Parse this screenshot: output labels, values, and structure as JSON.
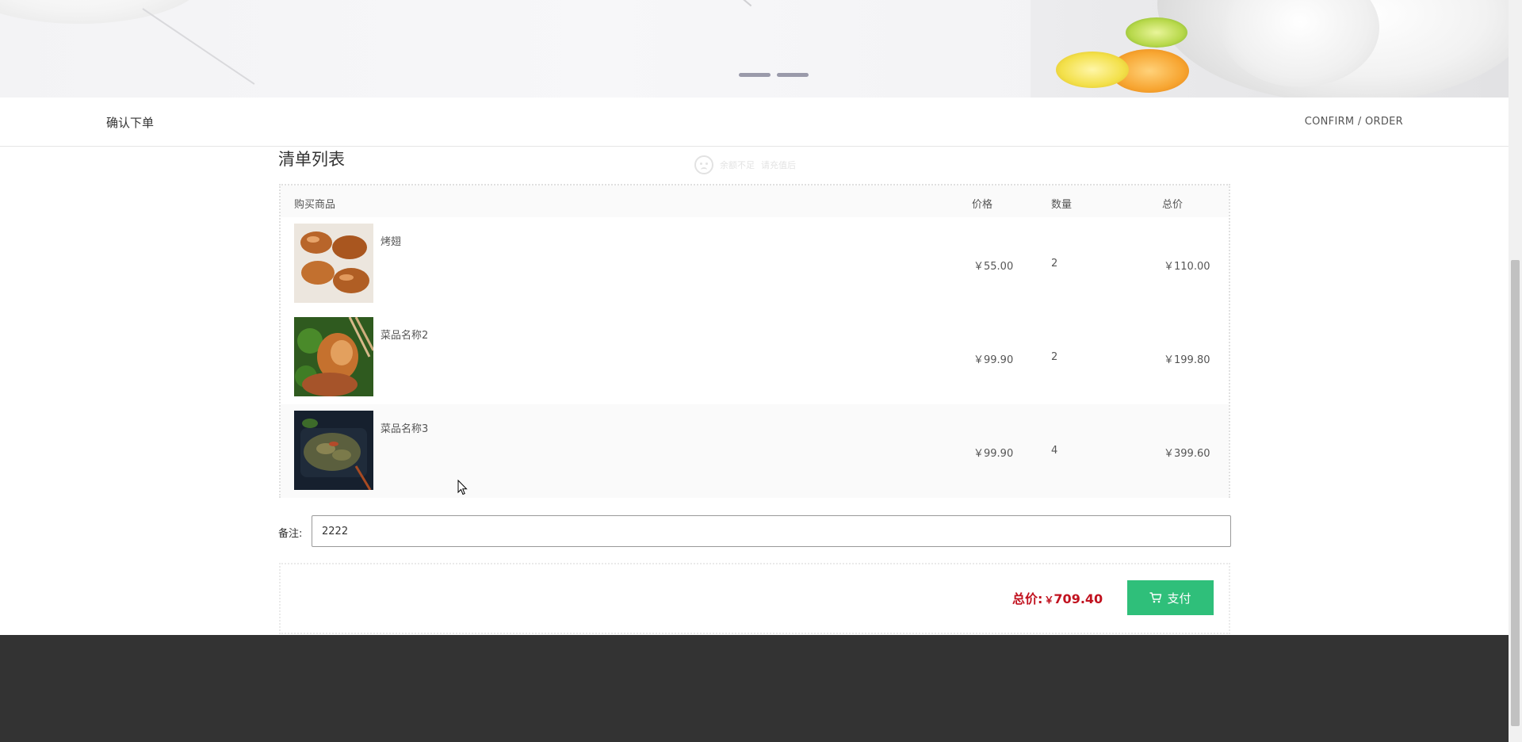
{
  "header": {
    "left_title": "确认下单",
    "right_title": "CONFIRM / ORDER"
  },
  "list": {
    "title": "清单列表",
    "empty_hint": [
      "余额不足",
      "请充值后"
    ],
    "columns": {
      "product": "购买商品",
      "price": "价格",
      "qty": "数量",
      "total": "总价"
    },
    "items": [
      {
        "name": "烤翅",
        "price": "￥55.00",
        "qty": "2",
        "subtotal": "￥110.00"
      },
      {
        "name": "菜品名称2",
        "price": "￥99.90",
        "qty": "2",
        "subtotal": "￥199.80"
      },
      {
        "name": "菜品名称3",
        "price": "￥99.90",
        "qty": "4",
        "subtotal": "￥399.60"
      }
    ]
  },
  "remark": {
    "label": "备注:",
    "value": "2222"
  },
  "summary": {
    "total_label": "总价:",
    "currency": "￥",
    "total_value": "709.40",
    "pay_label": "支付"
  },
  "colors": {
    "accent": "#2fbf7a",
    "price": "#c1121f",
    "footer": "#333333"
  },
  "icons": {
    "pay": "cart-icon",
    "empty": "sad-face-icon"
  }
}
